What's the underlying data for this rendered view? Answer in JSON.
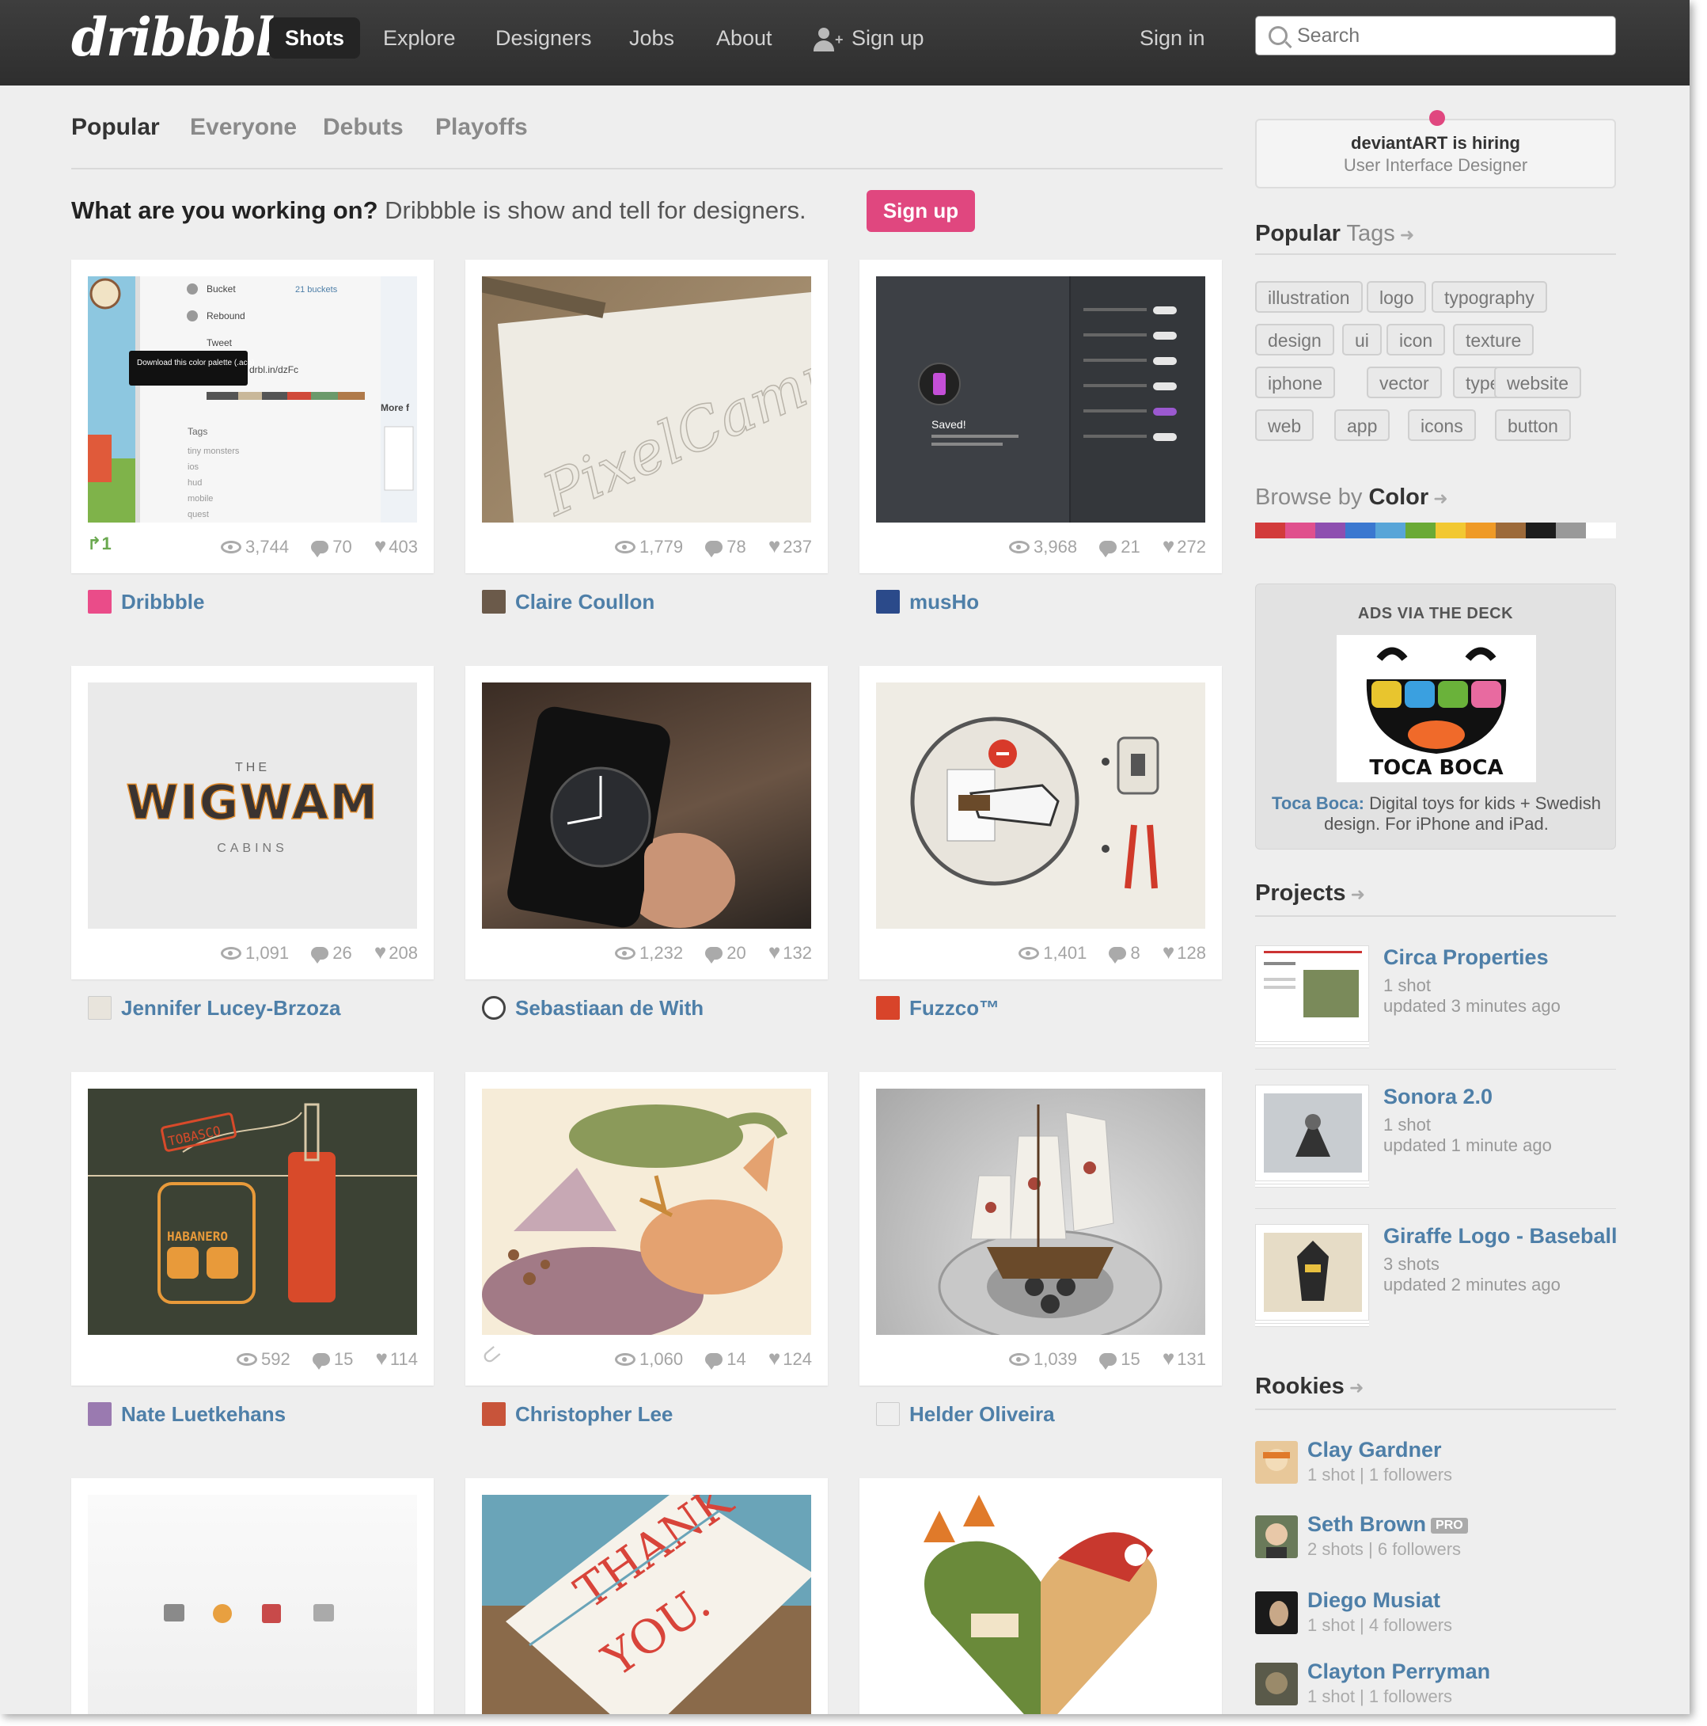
{
  "header": {
    "logo": "dribbble",
    "nav": [
      "Shots",
      "Explore",
      "Designers",
      "Jobs",
      "About"
    ],
    "signup": "Sign up",
    "signin": "Sign in",
    "search_placeholder": "Search"
  },
  "subnav": [
    "Popular",
    "Everyone",
    "Debuts",
    "Playoffs"
  ],
  "tagline": {
    "bold": "What are you working on?",
    "rest": " Dribbble is show and tell for designers.",
    "button": "Sign up"
  },
  "shots": [
    {
      "views": "3,744",
      "comments": "70",
      "likes": "403",
      "player": "Dribbble",
      "rebounds": "1"
    },
    {
      "views": "1,779",
      "comments": "78",
      "likes": "237",
      "player": "Claire Coullon"
    },
    {
      "views": "3,968",
      "comments": "21",
      "likes": "272",
      "player": "musHo"
    },
    {
      "views": "1,091",
      "comments": "26",
      "likes": "208",
      "player": "Jennifer Lucey-Brzoza"
    },
    {
      "views": "1,232",
      "comments": "20",
      "likes": "132",
      "player": "Sebastiaan de With"
    },
    {
      "views": "1,401",
      "comments": "8",
      "likes": "128",
      "player": "Fuzzco™"
    },
    {
      "views": "592",
      "comments": "15",
      "likes": "114",
      "player": "Nate Luetkehans"
    },
    {
      "views": "1,060",
      "comments": "14",
      "likes": "124",
      "player": "Christopher Lee"
    },
    {
      "views": "1,039",
      "comments": "15",
      "likes": "131",
      "player": "Helder Oliveira"
    }
  ],
  "thumb_text": {
    "bucket": "Bucket",
    "buckets_count": "21 buckets",
    "rebound": "Rebound",
    "tweet": "Tweet",
    "tooltip": "Download this color palette (.aco)",
    "short_link": "drbl.in/dzFc",
    "tags_label": "Tags",
    "tags": [
      "tiny monsters",
      "ios",
      "hud",
      "mobile",
      "quest"
    ],
    "more": "More f",
    "pixelcamp": "PixelCamp",
    "saved": "Saved!",
    "wigwam_the": "THE",
    "wigwam": "WIGWAM",
    "wigwam_cabins": "CABINS",
    "tobasco": "TOBASCO",
    "habanero": "HABANERO",
    "thank_you_1": "THANK",
    "thank_you_2": "YOU."
  },
  "sidebar": {
    "hiring": {
      "company": "deviantART is hiring",
      "role": "User Interface Designer"
    },
    "popular_tags": {
      "bold": "Popular",
      "light": " Tags"
    },
    "tags": [
      "illustration",
      "logo",
      "typography",
      "design",
      "ui",
      "icon",
      "texture",
      "iphone",
      "vector",
      "type",
      "website",
      "web",
      "app",
      "icons",
      "button"
    ],
    "browse": {
      "light": "Browse by ",
      "bold": "Color"
    },
    "colors": [
      "#d23b3b",
      "#e0508d",
      "#8e4fb0",
      "#3b78d0",
      "#58a5d8",
      "#6aaa36",
      "#f2c832",
      "#ef9a27",
      "#9d6a3a",
      "#1d1d1d",
      "#999999",
      "#ffffff"
    ],
    "deck": {
      "heading": "ADS VIA THE DECK",
      "logo_text": "TOCA BOCA",
      "brand": "Toca Boca:",
      "text": " Digital toys for kids + Swedish design. For iPhone and iPad."
    },
    "projects_title": "Projects",
    "projects": [
      {
        "name": "Circa Properties",
        "shots": "1 shot",
        "updated": "updated 3 minutes ago"
      },
      {
        "name": "Sonora 2.0",
        "shots": "1 shot",
        "updated": "updated 1 minute ago"
      },
      {
        "name": "Giraffe Logo - Baseball",
        "shots": "3 shots",
        "updated": "updated 2 minutes ago"
      }
    ],
    "rookies_title": "Rookies",
    "rookies": [
      {
        "name": "Clay Gardner",
        "meta": "1 shot  |  1 followers",
        "pro": ""
      },
      {
        "name": "Seth Brown",
        "meta": "2 shots  |  6 followers",
        "pro": "PRO"
      },
      {
        "name": "Diego Musiat",
        "meta": "1 shot  |  4 followers",
        "pro": ""
      },
      {
        "name": "Clayton Perryman",
        "meta": "1 shot  |  1 followers",
        "pro": ""
      }
    ]
  }
}
